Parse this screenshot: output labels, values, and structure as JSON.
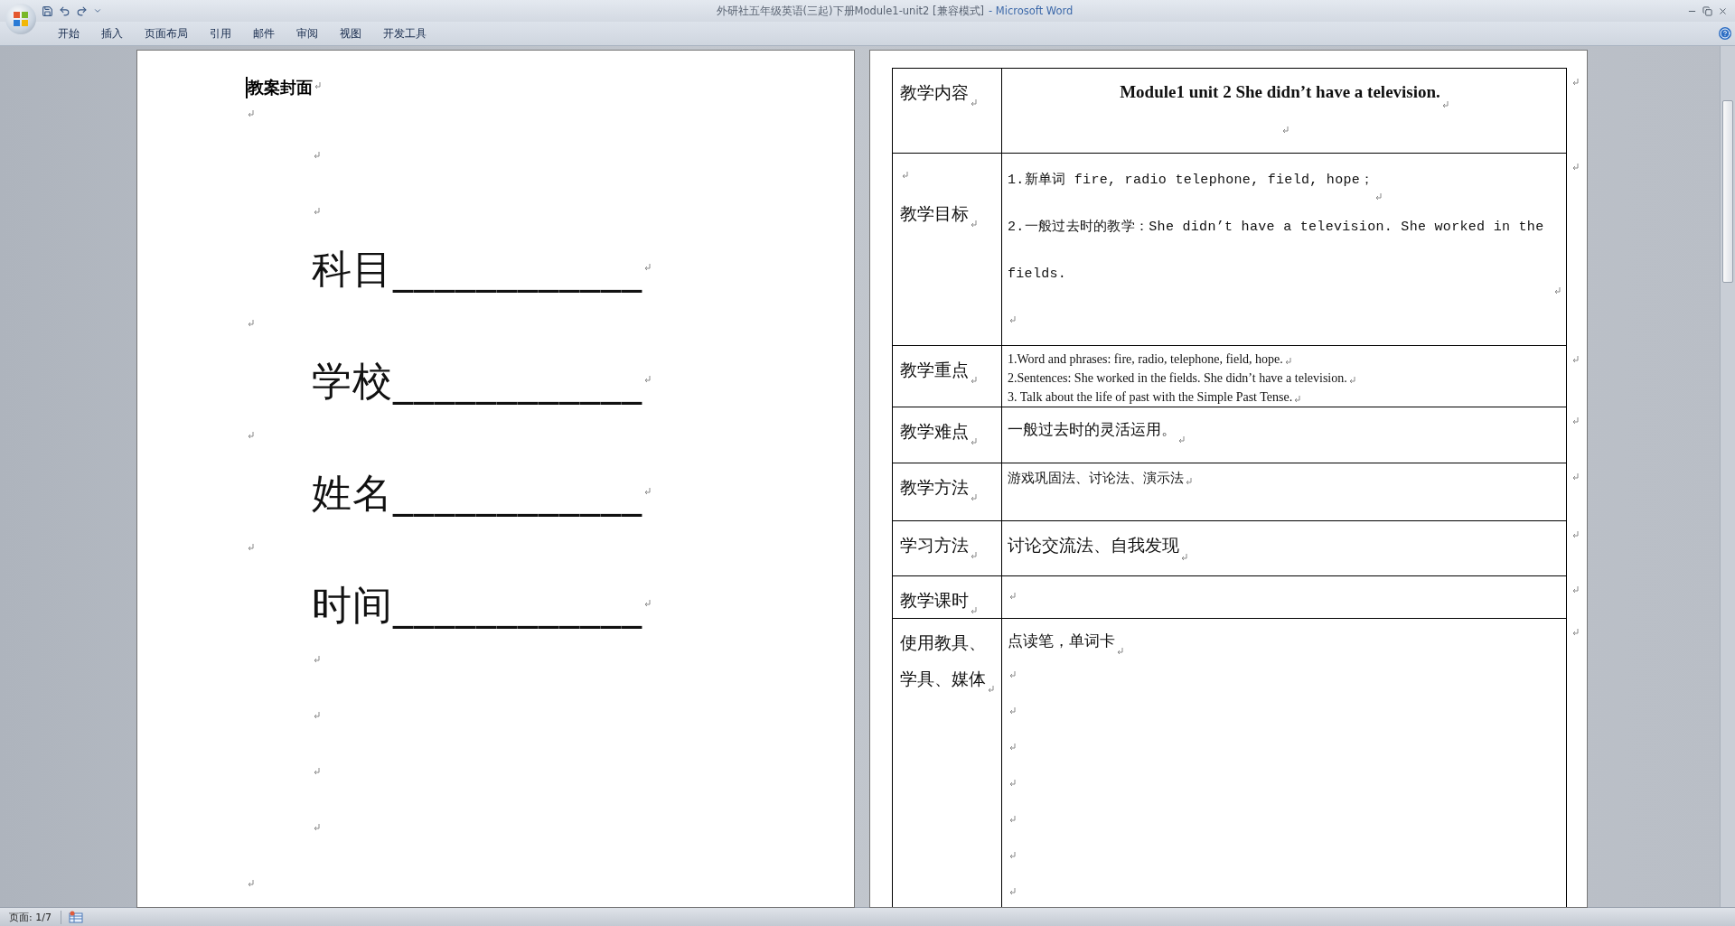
{
  "window": {
    "title": "外研社五年级英语(三起)下册Module1-unit2 [兼容模式]",
    "separator": "-",
    "app_name": "Microsoft Word"
  },
  "ribbon_tabs": [
    {
      "label": "开始",
      "selected": false
    },
    {
      "label": "插入",
      "selected": false
    },
    {
      "label": "页面布局",
      "selected": false
    },
    {
      "label": "引用",
      "selected": false
    },
    {
      "label": "邮件",
      "selected": false
    },
    {
      "label": "审阅",
      "selected": false
    },
    {
      "label": "视图",
      "selected": false
    },
    {
      "label": "开发工具",
      "selected": false
    }
  ],
  "cover_page": {
    "paragraphs": [
      {
        "kind": "heading",
        "text": "教案封面"
      },
      {
        "kind": "mark"
      },
      {
        "kind": "indented-mark"
      },
      {
        "kind": "indented-mark"
      },
      {
        "kind": "field",
        "text": "科目____________"
      },
      {
        "kind": "mark"
      },
      {
        "kind": "field",
        "text": "学校____________"
      },
      {
        "kind": "mark"
      },
      {
        "kind": "field",
        "text": "姓名____________"
      },
      {
        "kind": "mark"
      },
      {
        "kind": "field",
        "text": "时间____________"
      },
      {
        "kind": "indented-mark"
      },
      {
        "kind": "indented-mark"
      },
      {
        "kind": "indented-mark"
      },
      {
        "kind": "indented-mark"
      },
      {
        "kind": "mark"
      }
    ]
  },
  "lesson_table": {
    "rows": [
      {
        "label": [
          {
            "kind": "text",
            "text": "教学内容"
          }
        ],
        "kind": "title",
        "content": [
          {
            "kind": "text",
            "text": "Module1 unit 2    She didn’t have a television."
          },
          {
            "kind": "mark"
          }
        ]
      },
      {
        "label": [
          {
            "kind": "mark"
          },
          {
            "kind": "text",
            "text": "教学目标"
          }
        ],
        "kind": "mono",
        "content": [
          {
            "kind": "text",
            "text": "1.新单词 fire, radio telephone, field, hope；"
          },
          {
            "kind": "text",
            "text": "2.一般过去时的教学：She didn’t have a television. She worked in the fields."
          },
          {
            "kind": "mark"
          }
        ]
      },
      {
        "label": [
          {
            "kind": "text",
            "text": "教学重点"
          }
        ],
        "kind": "small",
        "content": [
          {
            "kind": "text",
            "text": "1.Word and phrases: fire, radio, telephone, field, hope."
          },
          {
            "kind": "text",
            "text": "2.Sentences: She worked in the fields. She didn’t have a television."
          },
          {
            "kind": "text",
            "text": "3. Talk about the life of past with the Simple Past Tense."
          }
        ]
      },
      {
        "label": [
          {
            "kind": "text",
            "text": "教学难点"
          }
        ],
        "kind": "cjk",
        "content": [
          {
            "kind": "text",
            "text": "一般过去时的灵活运用。"
          }
        ]
      },
      {
        "label": [
          {
            "kind": "text",
            "text": "教学方法"
          }
        ],
        "kind": "cjk-small",
        "content": [
          {
            "kind": "text",
            "text": "游戏巩固法、讨论法、演示法"
          }
        ]
      },
      {
        "label": [
          {
            "kind": "text",
            "text": "学习方法"
          }
        ],
        "kind": "cjk-large",
        "content": [
          {
            "kind": "text",
            "text": "讨论交流法、自我发现"
          }
        ]
      },
      {
        "label": [
          {
            "kind": "text",
            "text": "教学课时"
          }
        ],
        "kind": "cjk",
        "content": [
          {
            "kind": "mark"
          }
        ]
      },
      {
        "label": [
          {
            "kind": "text",
            "text": "使用教具、学具、媒体"
          }
        ],
        "kind": "cjk",
        "content": [
          {
            "kind": "text",
            "text": "点读笔，单词卡"
          },
          {
            "kind": "mark"
          },
          {
            "kind": "mark"
          },
          {
            "kind": "mark"
          },
          {
            "kind": "mark"
          },
          {
            "kind": "mark"
          },
          {
            "kind": "mark"
          },
          {
            "kind": "mark"
          }
        ]
      }
    ]
  },
  "status_bar": {
    "page": "页面: 1/7"
  }
}
